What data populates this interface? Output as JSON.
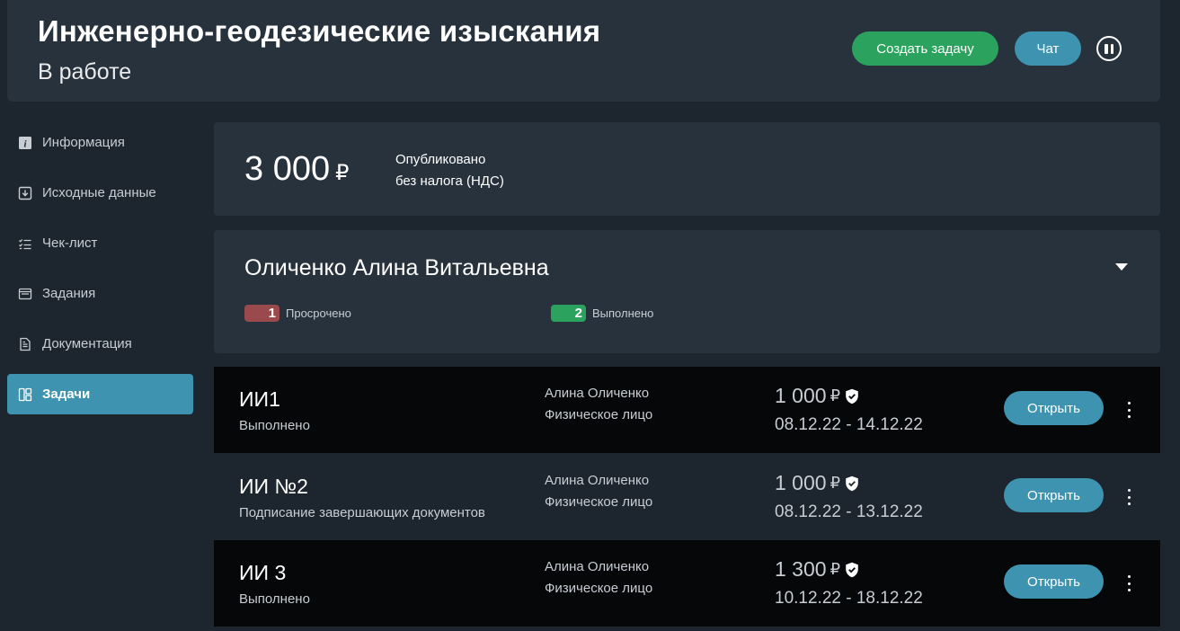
{
  "header": {
    "title": "Инженерно-геодезические изыскания",
    "subtitle": "В работе",
    "create_task_label": "Создать задачу",
    "chat_label": "Чат"
  },
  "sidebar": {
    "items": [
      {
        "label": "Информация",
        "icon": "info-icon"
      },
      {
        "label": "Исходные данные",
        "icon": "download-box-icon"
      },
      {
        "label": "Чек-лист",
        "icon": "checklist-icon"
      },
      {
        "label": "Задания",
        "icon": "window-stack-icon"
      },
      {
        "label": "Документация",
        "icon": "document-icon"
      },
      {
        "label": "Задачи",
        "icon": "dashboard-icon",
        "active": true
      }
    ]
  },
  "price": {
    "amount": "3 000",
    "currency": "₽",
    "status": "Опубликовано",
    "tax_note": "без налога (НДС)"
  },
  "executor": {
    "name": "Оличенко Алина Витальевна",
    "overdue_count": "1",
    "overdue_label": "Просрочено",
    "done_count": "2",
    "done_label": "Выполнено"
  },
  "tasks": [
    {
      "title": "ИИ1",
      "status": "Выполнено",
      "executor_name": "Алина Оличенко",
      "executor_type": "Физическое лицо",
      "price": "1 000",
      "currency": "₽",
      "dates": "08.12.22 - 14.12.22",
      "open_label": "Открыть"
    },
    {
      "title": "ИИ №2",
      "status": "Подписание завершающих документов",
      "executor_name": "Алина Оличенко",
      "executor_type": "Физическое лицо",
      "price": "1 000",
      "currency": "₽",
      "dates": "08.12.22 - 13.12.22",
      "open_label": "Открыть"
    },
    {
      "title": "ИИ 3",
      "status": "Выполнено",
      "executor_name": "Алина Оличенко",
      "executor_type": "Физическое лицо",
      "price": "1 300",
      "currency": "₽",
      "dates": "10.12.22 - 18.12.22",
      "open_label": "Открыть"
    }
  ],
  "colors": {
    "background": "#1d262e",
    "card": "#28323c",
    "accent_blue": "#3e94b0",
    "accent_green": "#2ba35e",
    "overdue_red": "#9a4a4c",
    "row_dark": "#050708"
  }
}
